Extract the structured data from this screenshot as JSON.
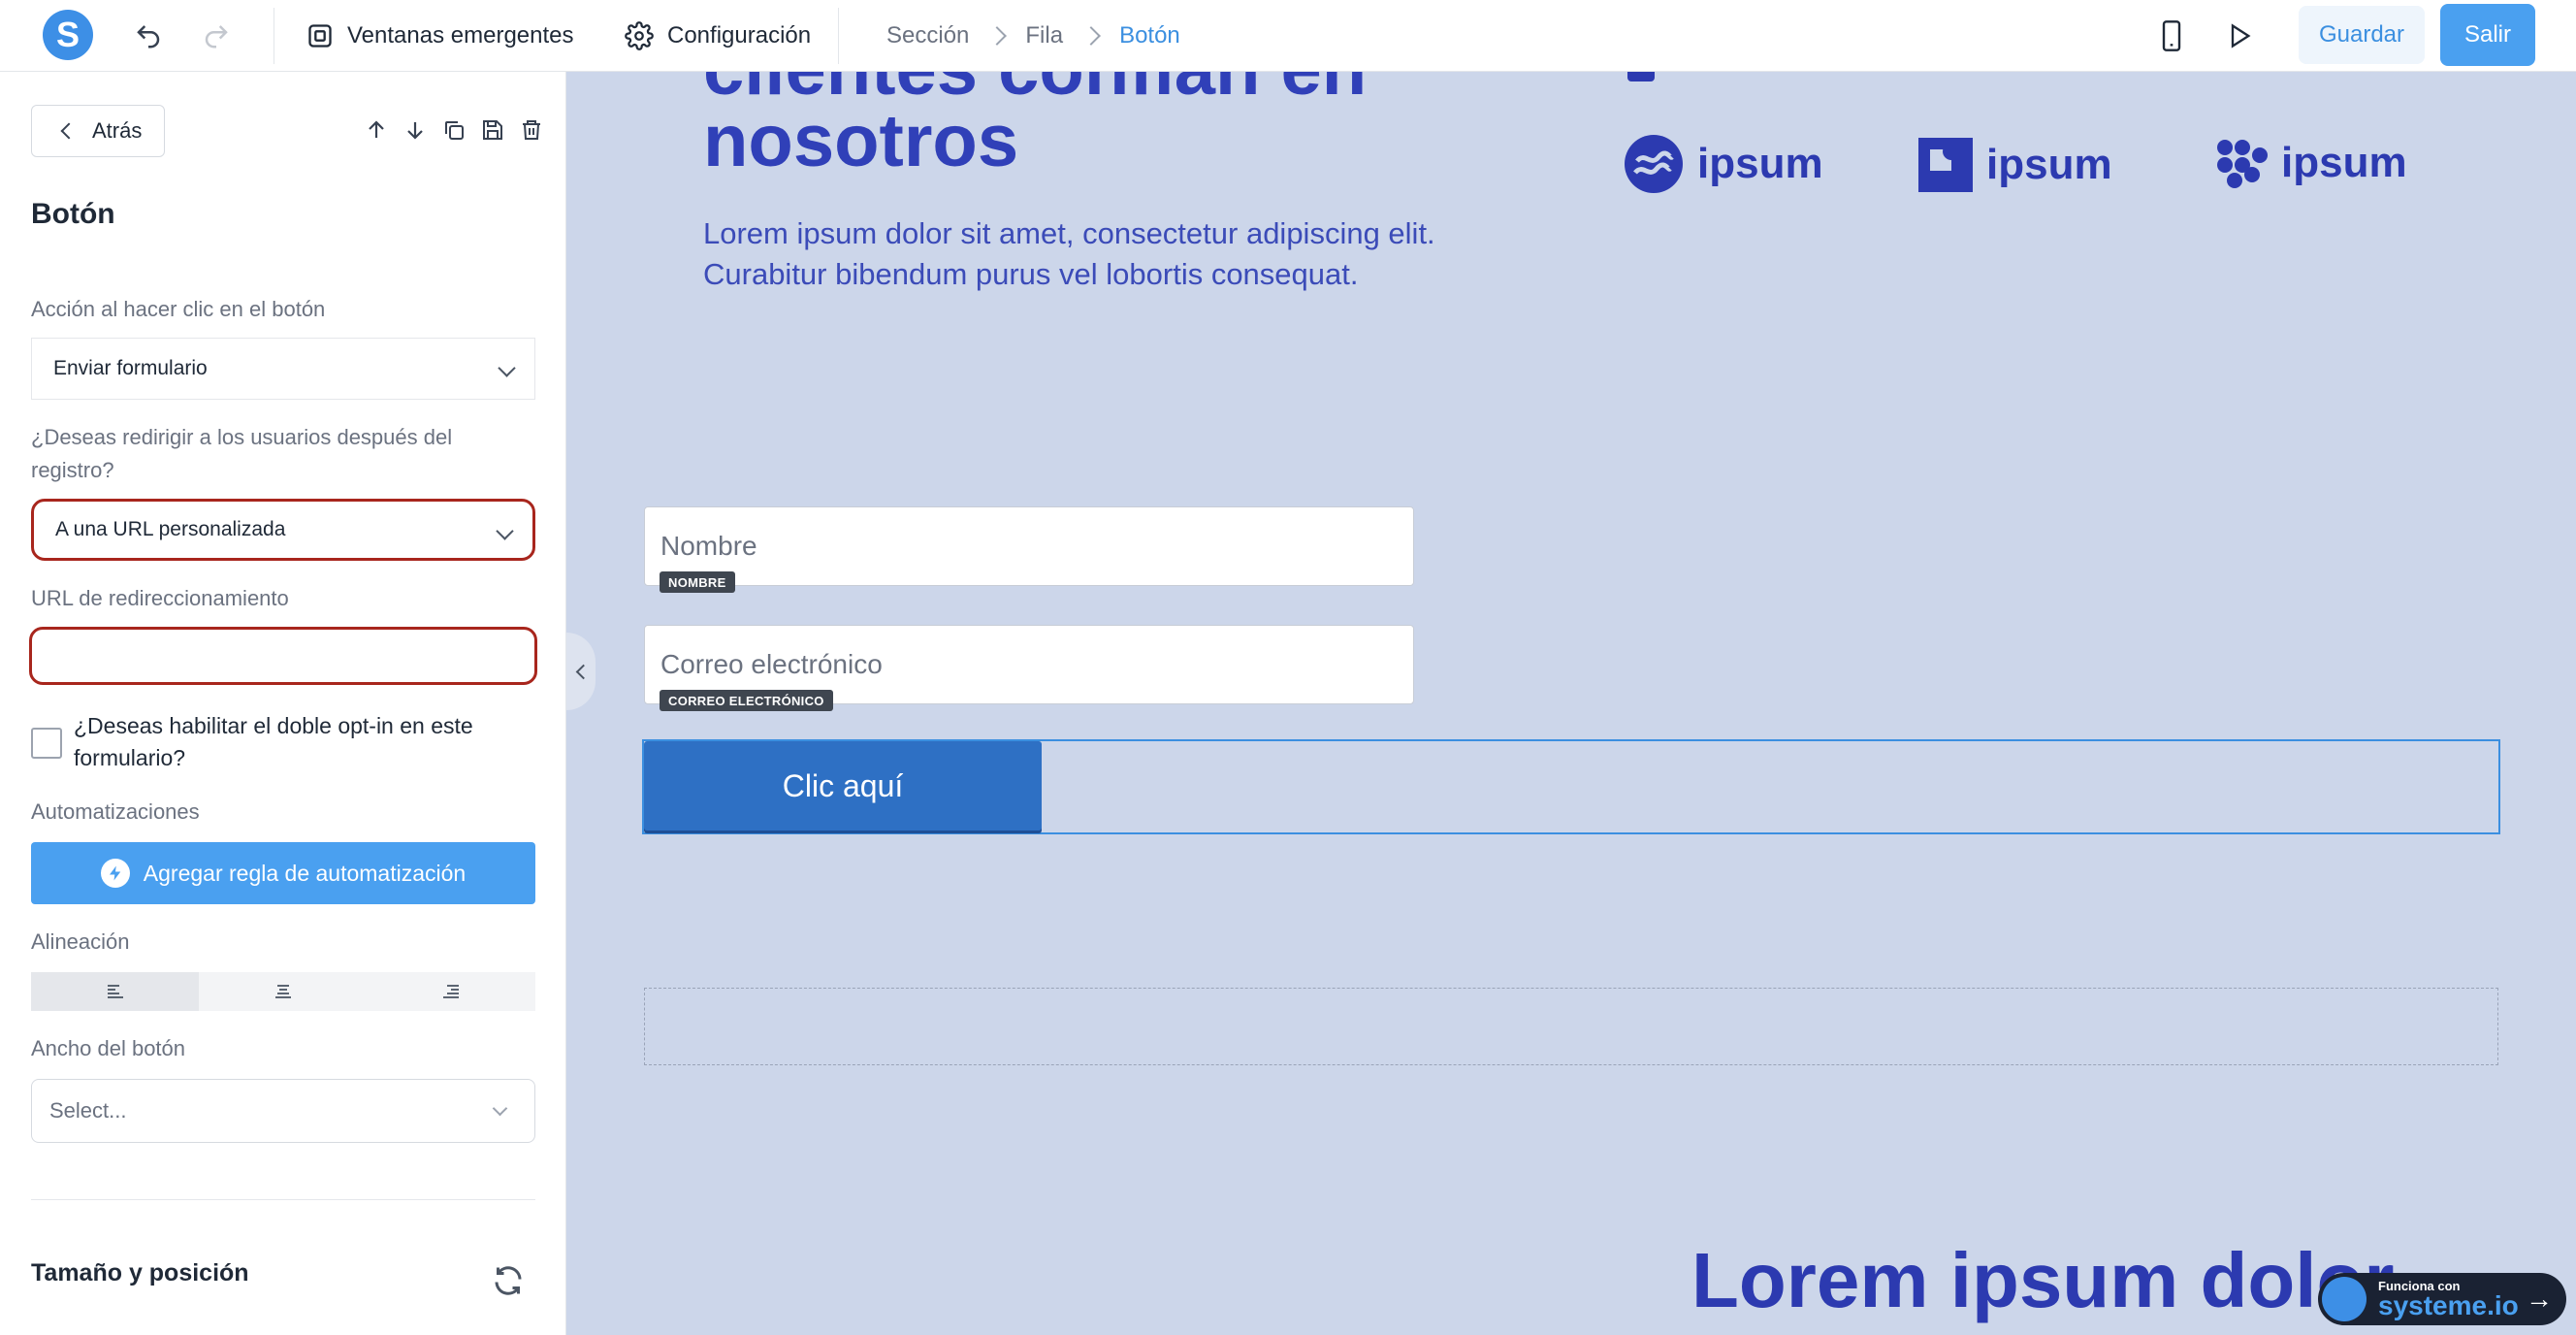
{
  "topbar": {
    "logo_letter": "S",
    "popups_label": "Ventanas emergentes",
    "settings_label": "Configuración",
    "breadcrumbs": [
      "Sección",
      "Fila",
      "Botón"
    ],
    "save_label": "Guardar",
    "exit_label": "Salir"
  },
  "panel": {
    "back_label": "Atrás",
    "title": "Botón",
    "action_label": "Acción al hacer clic en el botón",
    "action_value": "Enviar formulario",
    "redirect_question": "¿Deseas redirigir a los usuarios después del registro?",
    "redirect_value": "A una URL personalizada",
    "redirect_url_label": "URL de redireccionamiento",
    "redirect_url_value": "",
    "double_optin_label": "¿Deseas habilitar el doble opt-in en este formulario?",
    "double_optin_checked": false,
    "automations_label": "Automatizaciones",
    "add_rule_label": "Agregar regla de automatización",
    "alignment_label": "Alineación",
    "alignment_selected": "left",
    "width_label": "Ancho del botón",
    "width_placeholder": "Select...",
    "size_position_label": "Tamaño y posición"
  },
  "canvas": {
    "hero_line1": "clientes confían en",
    "hero_line2": "nosotros",
    "hero_subtitle": "Lorem ipsum dolor sit amet, consectetur adipiscing elit. Curabitur bibendum purus vel lobortis consequat.",
    "logos": [
      "ipsum",
      "ipsum",
      "ipsum"
    ],
    "name_placeholder": "Nombre",
    "name_tag": "NOMBRE",
    "email_placeholder": "Correo electrónico",
    "email_tag": "CORREO ELECTRÓNICO",
    "cta_label": "Clic aquí",
    "bottom_title": "Lorem ipsum dolor",
    "powered_small": "Funciona con",
    "powered_brand": "systeme.io"
  },
  "colors": {
    "accent": "#4aa0f0",
    "canvas_bg": "#ccd6ea",
    "hero_text": "#3040b8",
    "error": "#a8261d",
    "cta": "#2e70c4"
  }
}
